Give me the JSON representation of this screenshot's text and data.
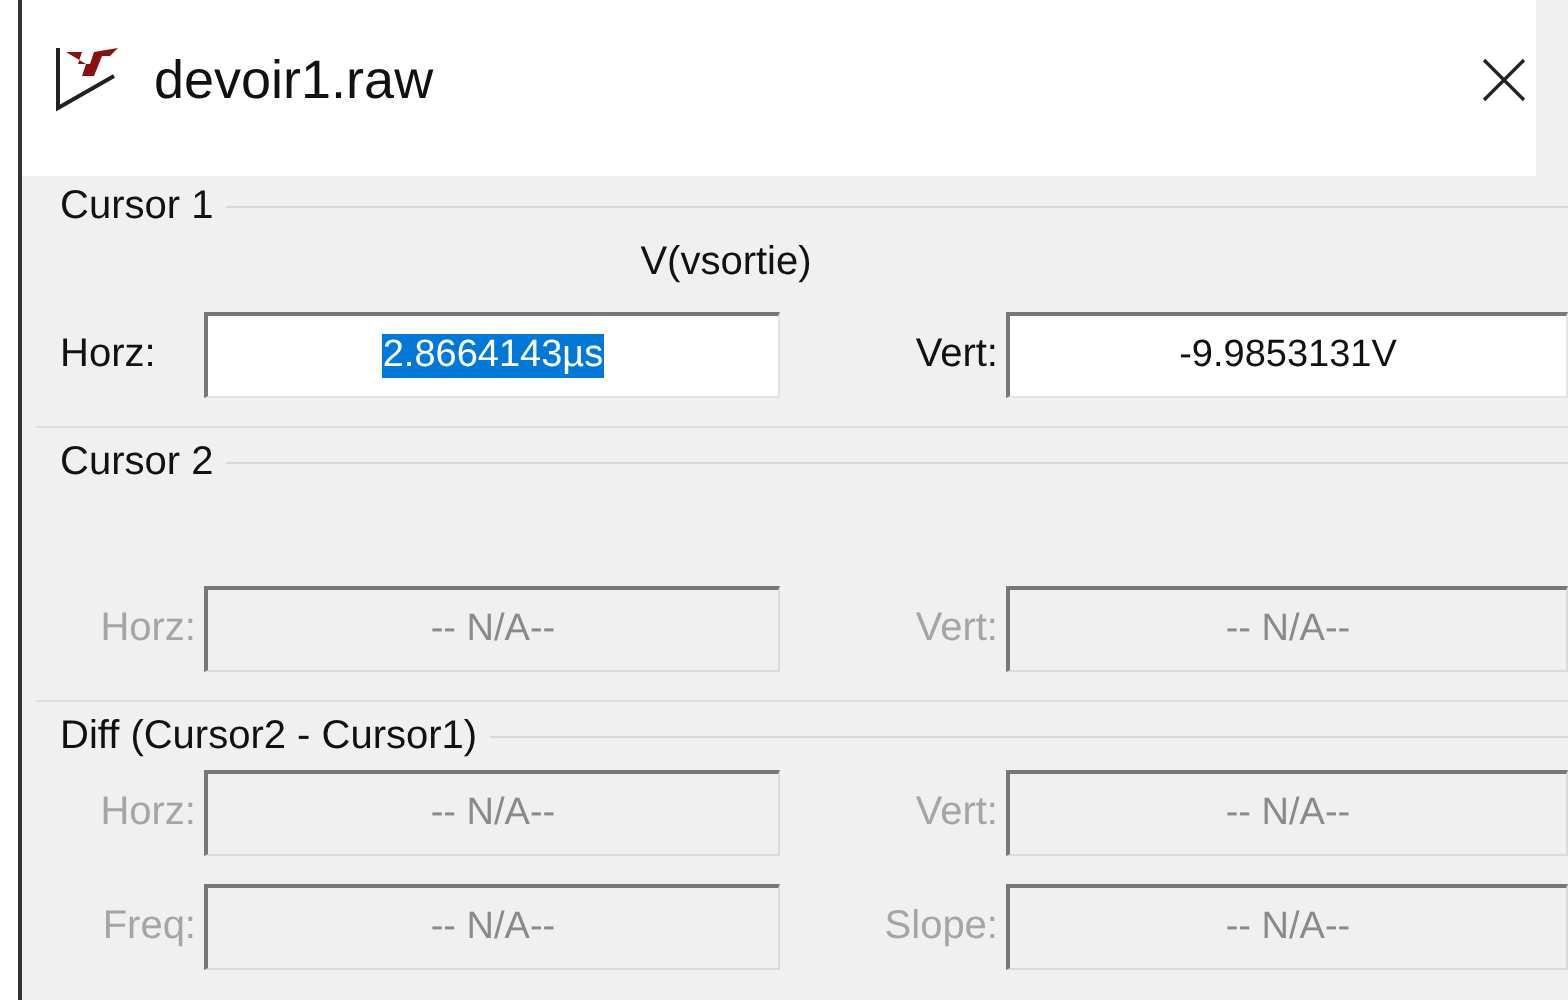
{
  "window": {
    "title": "devoir1.raw"
  },
  "groups": [
    {
      "label": "Cursor 1",
      "signal": "V(vsortie)",
      "rows": [
        [
          {
            "label": "Horz:",
            "value": "2.8664143µs",
            "disabled": false,
            "text_selected": true
          },
          {
            "label": "Vert:",
            "value": "-9.9853131V",
            "disabled": false,
            "text_selected": false
          }
        ]
      ]
    },
    {
      "label": "Cursor 2",
      "rows": [
        [
          {
            "label": "Horz:",
            "value": "-- N/A--",
            "disabled": true,
            "text_selected": false
          },
          {
            "label": "Vert:",
            "value": "-- N/A--",
            "disabled": true,
            "text_selected": false
          }
        ]
      ]
    },
    {
      "label": "Diff (Cursor2 - Cursor1)",
      "rows": [
        [
          {
            "label": "Horz:",
            "value": "-- N/A--",
            "disabled": true,
            "text_selected": false
          },
          {
            "label": "Vert:",
            "value": "-- N/A--",
            "disabled": true,
            "text_selected": false
          }
        ],
        [
          {
            "label": "Freq:",
            "value": "-- N/A--",
            "disabled": true,
            "text_selected": false
          },
          {
            "label": "Slope:",
            "value": "-- N/A--",
            "disabled": true,
            "text_selected": false
          }
        ]
      ]
    }
  ]
}
